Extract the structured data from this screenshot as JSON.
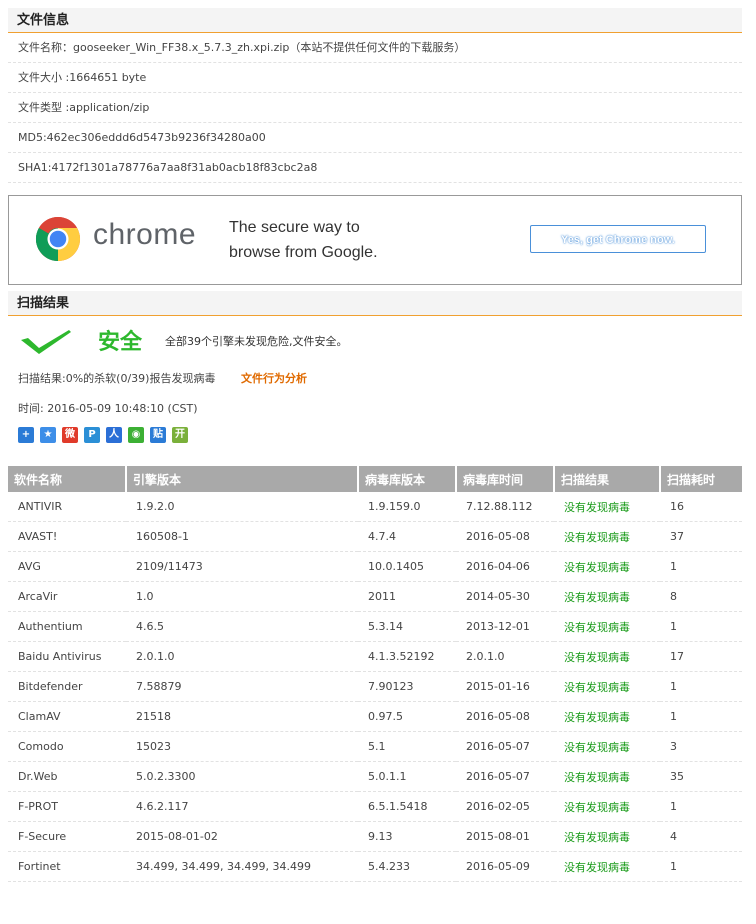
{
  "file_info": {
    "heading": "文件信息",
    "name_row": "文件名称：gooseeker_Win_FF38.x_5.7.3_zh.xpi.zip（本站不提供任何文件的下载服务）",
    "size_row": "文件大小 :1664651 byte",
    "type_row": "文件类型 :application/zip",
    "md5_row": "MD5:462ec306eddd6d5473b9236f34280a00",
    "sha1_row": "SHA1:4172f1301a78776a7aa8f31ab0acb18f83cbc2a8"
  },
  "banner": {
    "brand": "chrome",
    "tagline_1": "The secure way to",
    "tagline_2": "browse from Google.",
    "cta": "Yes, get Chrome now."
  },
  "scan": {
    "heading": "扫描结果",
    "verdict": "安全",
    "verdict_desc": "全部39个引擎未发现危险,文件安全。",
    "summary": "扫描结果:0%的杀软(0/39)报告发现病毒",
    "behavior_link": "文件行为分析",
    "time": "时间: 2016-05-09 10:48:10 (CST)"
  },
  "table": {
    "headers": [
      "软件名称",
      "引擎版本",
      "病毒库版本",
      "病毒库时间",
      "扫描结果",
      "扫描耗时"
    ],
    "rows": [
      [
        "ANTIVIR",
        "1.9.2.0",
        "1.9.159.0",
        "7.12.88.112",
        "没有发现病毒",
        "16"
      ],
      [
        "AVAST!",
        "160508-1",
        "4.7.4",
        "2016-05-08",
        "没有发现病毒",
        "37"
      ],
      [
        "AVG",
        "2109/11473",
        "10.0.1405",
        "2016-04-06",
        "没有发现病毒",
        "1"
      ],
      [
        "ArcaVir",
        "1.0",
        "2011",
        "2014-05-30",
        "没有发现病毒",
        "8"
      ],
      [
        "Authentium",
        "4.6.5",
        "5.3.14",
        "2013-12-01",
        "没有发现病毒",
        "1"
      ],
      [
        "Baidu Antivirus",
        "2.0.1.0",
        "4.1.3.52192",
        "2.0.1.0",
        "没有发现病毒",
        "17"
      ],
      [
        "Bitdefender",
        "7.58879",
        "7.90123",
        "2015-01-16",
        "没有发现病毒",
        "1"
      ],
      [
        "ClamAV",
        "21518",
        "0.97.5",
        "2016-05-08",
        "没有发现病毒",
        "1"
      ],
      [
        "Comodo",
        "15023",
        "5.1",
        "2016-05-07",
        "没有发现病毒",
        "3"
      ],
      [
        "Dr.Web",
        "5.0.2.3300",
        "5.0.1.1",
        "2016-05-07",
        "没有发现病毒",
        "35"
      ],
      [
        "F-PROT",
        "4.6.2.117",
        "6.5.1.5418",
        "2016-02-05",
        "没有发现病毒",
        "1"
      ],
      [
        "F-Secure",
        "2015-08-01-02",
        "9.13",
        "2015-08-01",
        "没有发现病毒",
        "4"
      ],
      [
        "Fortinet",
        "34.499, 34.499, 34.499, 34.499",
        "5.4.233",
        "2016-05-09",
        "没有发现病毒",
        "1"
      ]
    ]
  },
  "share_icons": [
    "qzone-plus-icon",
    "qq-star-icon",
    "weibo-icon",
    "tencent-weibo-icon",
    "renren-icon",
    "wechat-icon",
    "tieba-icon",
    "kaixin-icon"
  ],
  "share_glyphs": [
    "+",
    "★",
    "微",
    "P",
    "人",
    "◉",
    "贴",
    "开"
  ],
  "colors": {
    "accent": "#f0a030",
    "safe": "#2db82d",
    "link": "#e06a00",
    "header_bg": "#a9a9a9"
  }
}
